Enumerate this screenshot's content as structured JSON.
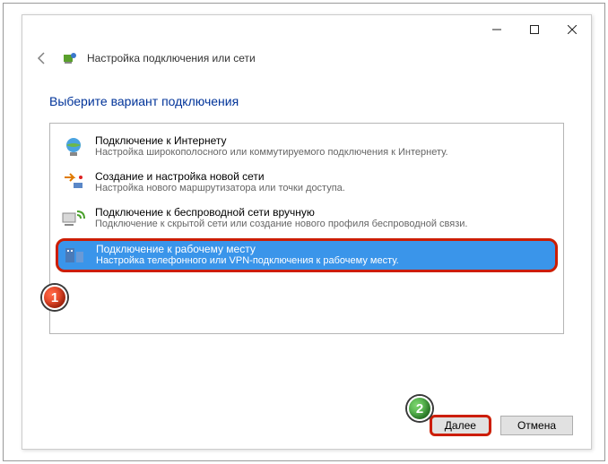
{
  "window": {
    "title": "Настройка подключения или сети"
  },
  "heading": "Выберите вариант подключения",
  "options": [
    {
      "title": "Подключение к Интернету",
      "desc": "Настройка широкополосного или коммутируемого подключения к Интернету."
    },
    {
      "title": "Создание и настройка новой сети",
      "desc": "Настройка нового маршрутизатора или точки доступа."
    },
    {
      "title": "Подключение к беспроводной сети вручную",
      "desc": "Подключение к скрытой сети или создание нового профиля беспроводной связи."
    },
    {
      "title": "Подключение к рабочему месту",
      "desc": "Настройка телефонного или VPN-подключения к рабочему месту."
    }
  ],
  "buttons": {
    "next": "Далее",
    "cancel": "Отмена"
  },
  "markers": {
    "one": "1",
    "two": "2"
  }
}
